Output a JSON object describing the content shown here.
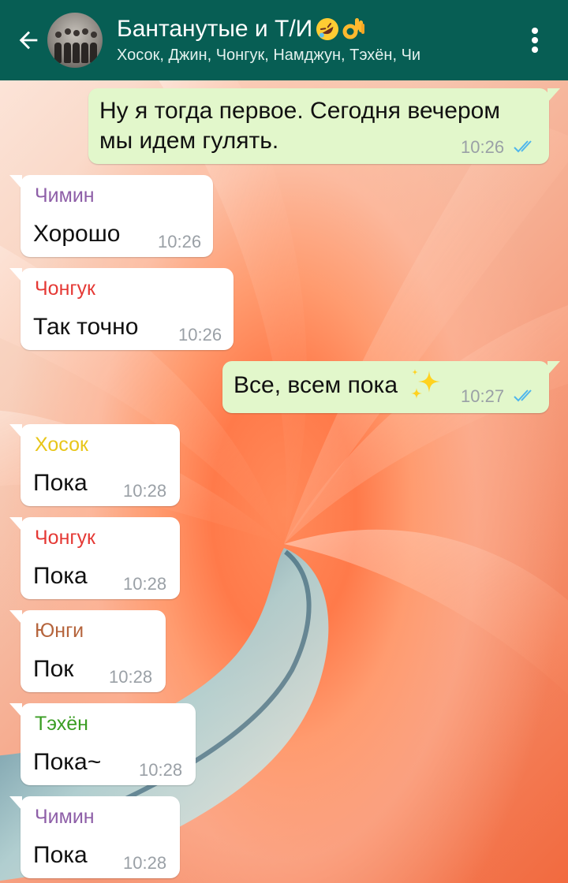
{
  "header": {
    "title": "Бантанутые и Т/И",
    "title_emojis": [
      "rolling-on-floor-laughing-emoji",
      "ok-hand-emoji"
    ],
    "subtitle": "Хосок, Джин, Чонгук, Намджун, Тэхён, Чи",
    "back_icon": "arrow-left-icon",
    "menu_icon": "more-vert-icon",
    "color": "#075e54"
  },
  "messages": [
    {
      "direction": "out",
      "text_line1": "Ну я тогда первое. Сегодня вечером",
      "text_line2": "мы идем гулять.",
      "time": "10:26",
      "status": "read"
    },
    {
      "direction": "in",
      "sender": "Чимин",
      "sender_color": "#8e5fa8",
      "text": "Хорошо",
      "time": "10:26"
    },
    {
      "direction": "in",
      "sender": "Чонгук",
      "sender_color": "#e53935",
      "text": "Так точно",
      "time": "10:26"
    },
    {
      "direction": "out",
      "text": "Все, всем пока",
      "emoji": "sparkles-emoji",
      "time": "10:27",
      "status": "read"
    },
    {
      "direction": "in",
      "sender": "Хосок",
      "sender_color": "#e8c619",
      "text": "Пока",
      "time": "10:28"
    },
    {
      "direction": "in",
      "sender": "Чонгук",
      "sender_color": "#e53935",
      "text": "Пока",
      "time": "10:28"
    },
    {
      "direction": "in",
      "sender": "Юнги",
      "sender_color": "#b5643c",
      "text": "Пок",
      "time": "10:28"
    },
    {
      "direction": "in",
      "sender": "Тэхён",
      "sender_color": "#3a9d23",
      "text": "Пока~",
      "time": "10:28"
    },
    {
      "direction": "in",
      "sender": "Чимин",
      "sender_color": "#8e5fa8",
      "text": "Пока",
      "time": "10:28"
    }
  ],
  "colors": {
    "incoming_bubble": "#ffffff",
    "outgoing_bubble": "#e2f7cb",
    "read_checks": "#4fb6ec"
  }
}
